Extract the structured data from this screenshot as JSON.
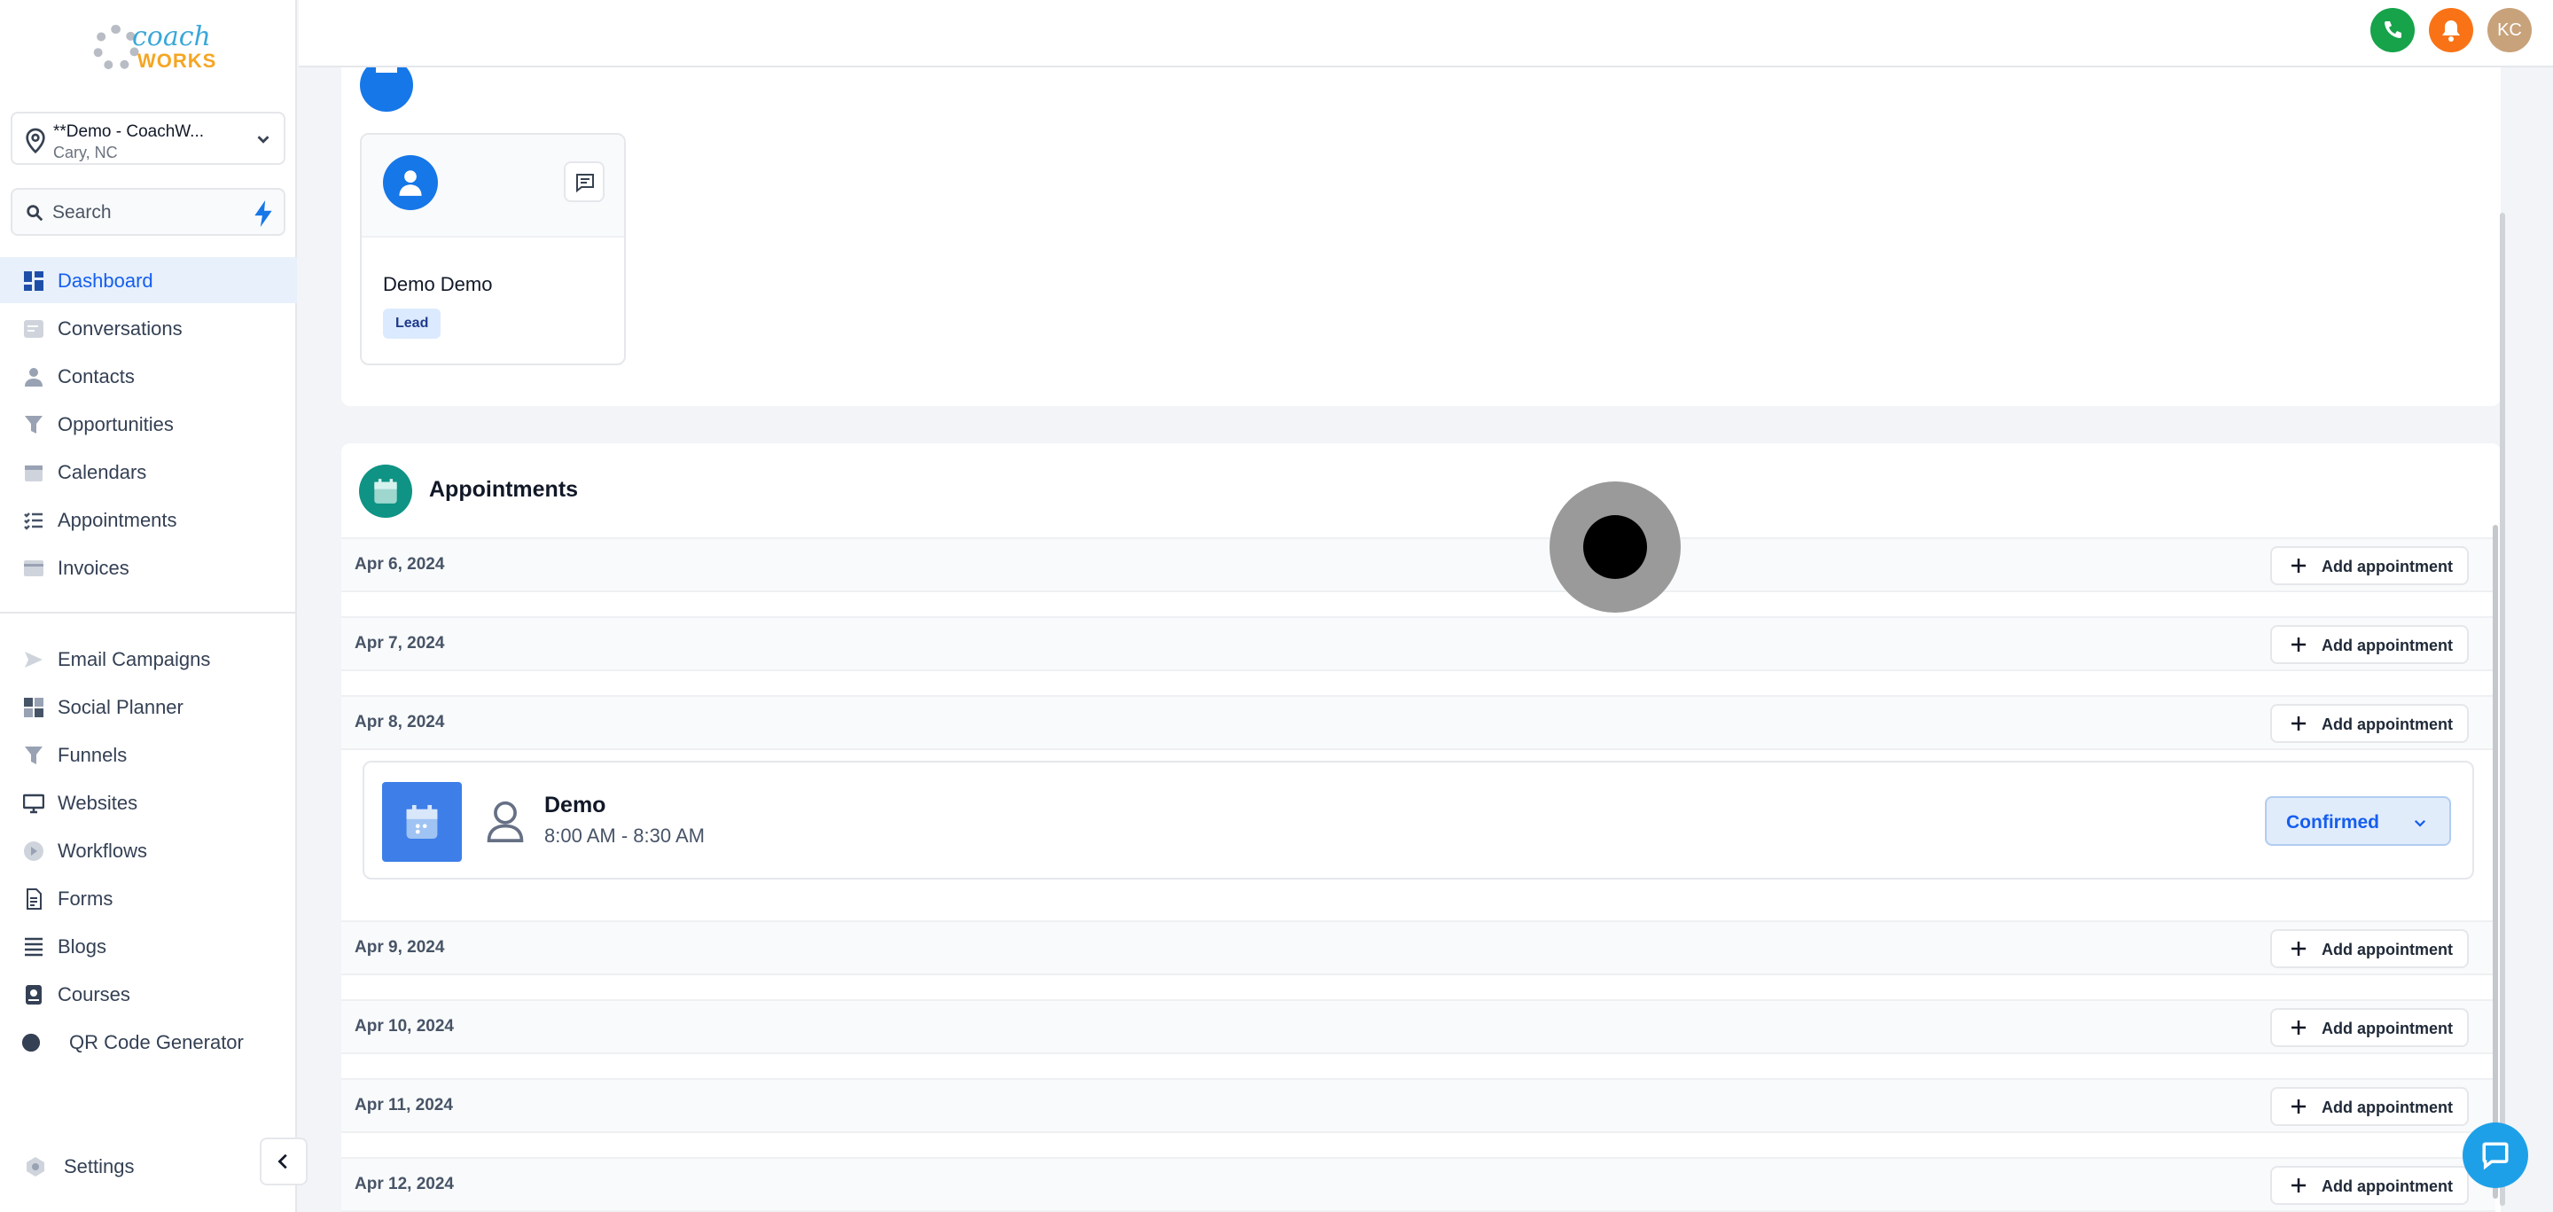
{
  "brand": {
    "logo_top": "coach",
    "logo_bottom": "WORKS"
  },
  "location": {
    "name": "**Demo - CoachW...",
    "city": "Cary, NC"
  },
  "search": {
    "placeholder": "Search"
  },
  "sidebar": {
    "items": [
      {
        "label": "Dashboard",
        "icon": "dashboard-icon",
        "active": true
      },
      {
        "label": "Conversations",
        "icon": "chat-icon"
      },
      {
        "label": "Contacts",
        "icon": "person-icon"
      },
      {
        "label": "Opportunities",
        "icon": "funnel-icon"
      },
      {
        "label": "Calendars",
        "icon": "calendar-icon"
      },
      {
        "label": "Appointments",
        "icon": "list-icon"
      },
      {
        "label": "Invoices",
        "icon": "invoice-icon"
      },
      {
        "label": "Email Campaigns",
        "icon": "send-icon"
      },
      {
        "label": "Social Planner",
        "icon": "grid-icon"
      },
      {
        "label": "Funnels",
        "icon": "funnel-icon"
      },
      {
        "label": "Websites",
        "icon": "monitor-icon"
      },
      {
        "label": "Workflows",
        "icon": "workflow-icon"
      },
      {
        "label": "Forms",
        "icon": "form-icon"
      },
      {
        "label": "Blogs",
        "icon": "lines-icon"
      },
      {
        "label": "Courses",
        "icon": "course-icon"
      },
      {
        "label": "QR Code Generator",
        "icon": "qr-icon"
      }
    ],
    "settings": "Settings"
  },
  "header": {
    "avatar_initials": "KC",
    "colors": {
      "phone": "#16a34a",
      "bell": "#f97316",
      "avatar": "#c8a27a"
    }
  },
  "contact_card": {
    "name": "Demo Demo",
    "badge": "Lead"
  },
  "appointments": {
    "title": "Appointments",
    "add_label": "Add appointment",
    "days": [
      "Apr 6, 2024",
      "Apr 7, 2024",
      "Apr 8, 2024",
      "Apr 9, 2024",
      "Apr 10, 2024",
      "Apr 11, 2024",
      "Apr 12, 2024"
    ],
    "event": {
      "title": "Demo",
      "time": "8:00 AM - 8:30 AM",
      "status": "Confirmed"
    }
  }
}
